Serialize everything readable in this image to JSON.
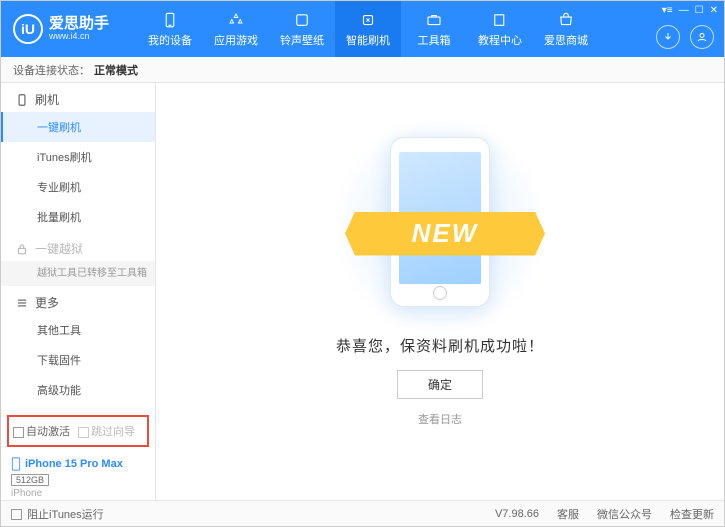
{
  "logo": {
    "glyph": "iU",
    "title": "爱思助手",
    "subtitle": "www.i4.cn"
  },
  "nav": {
    "items": [
      {
        "label": "我的设备"
      },
      {
        "label": "应用游戏"
      },
      {
        "label": "铃声壁纸"
      },
      {
        "label": "智能刷机"
      },
      {
        "label": "工具箱"
      },
      {
        "label": "教程中心"
      },
      {
        "label": "爱思商城"
      }
    ]
  },
  "status": {
    "prefix": "设备连接状态：",
    "mode": "正常模式"
  },
  "sidebar": {
    "section_flash": "刷机",
    "items_flash": [
      "一键刷机",
      "iTunes刷机",
      "专业刷机",
      "批量刷机"
    ],
    "section_jailbreak": "一键越狱",
    "jailbreak_note": "越狱工具已转移至工具箱",
    "section_more": "更多",
    "items_more": [
      "其他工具",
      "下载固件",
      "高级功能"
    ],
    "cb_auto_activate": "自动激活",
    "cb_skip_guide": "跳过向导"
  },
  "device": {
    "name": "iPhone 15 Pro Max",
    "storage": "512GB",
    "type": "iPhone"
  },
  "main": {
    "ribbon": "NEW",
    "success": "恭喜您，保资料刷机成功啦！",
    "ok": "确定",
    "log": "查看日志"
  },
  "footer": {
    "block_itunes": "阻止iTunes运行",
    "version": "V7.98.66",
    "service": "客服",
    "wechat": "微信公众号",
    "update": "检查更新"
  }
}
